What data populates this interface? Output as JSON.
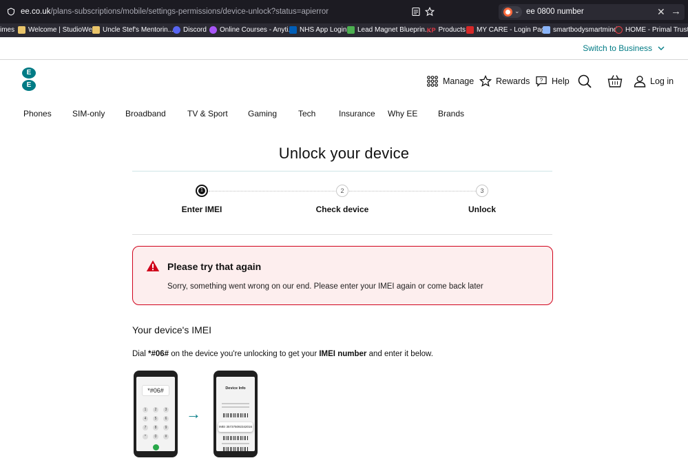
{
  "browser": {
    "url_host": "ee.co.uk",
    "url_path": "/plans-subscriptions/mobile/settings-permissions/device-unlock?status=apierror",
    "search_text": "ee 0800 number",
    "bookmarks": [
      {
        "label": "imes",
        "color": "#2b2a33"
      },
      {
        "label": "Welcome | StudioWeb",
        "color": "#e9c46a"
      },
      {
        "label": "Uncle Stef's Mentorin...",
        "color": "#e9c46a"
      },
      {
        "label": "Discord",
        "color": "#5865f2"
      },
      {
        "label": "Online Courses - Anyti...",
        "color": "#a855f7"
      },
      {
        "label": "NHS App Login",
        "color": "#005eb8"
      },
      {
        "label": "Lead Magnet Blueprin...",
        "color": "#4caf50"
      },
      {
        "label": "Products",
        "color": "#e63946"
      },
      {
        "label": "MY CARE - Login Page",
        "color": "#d62828"
      },
      {
        "label": "smartbodysmartmind",
        "color": "#8ab4f8"
      },
      {
        "label": "HOME - Primal Trust™...",
        "color": "#333333"
      }
    ],
    "bookmark_prefix_kp": "KP"
  },
  "bizbar": {
    "switch_label": "Switch to Business"
  },
  "header": {
    "logo_letters": [
      "E",
      "E"
    ],
    "manage": "Manage",
    "rewards": "Rewards",
    "help": "Help",
    "login": "Log in"
  },
  "mainnav": [
    "Phones",
    "SIM-only",
    "Broadband",
    "TV & Sport",
    "Gaming",
    "Tech",
    "Insurance",
    "Why EE",
    "Brands"
  ],
  "page": {
    "title": "Unlock your device",
    "steps": [
      {
        "number": "1",
        "label": "Enter IMEI"
      },
      {
        "number": "2",
        "label": "Check device"
      },
      {
        "number": "3",
        "label": "Unlock"
      }
    ],
    "alert": {
      "title": "Please try that again",
      "message": "Sorry, something went wrong on our end. Please enter your IMEI again or come back later"
    },
    "imei_heading": "Your device's IMEI",
    "dial": {
      "prefix": "Dial ",
      "code": "*#06#",
      "middle": " on the device you're unlocking to get your ",
      "emphasis": "IMEI number",
      "suffix": " and enter it below."
    },
    "illustration": {
      "dial_code": "*#06#",
      "keys": [
        "1",
        "2",
        "3",
        "4",
        "5",
        "6",
        "7",
        "8",
        "9",
        "*",
        "0",
        "#"
      ],
      "device_info_title": "Device Info",
      "imei_popup": "IMEI 357375092342016"
    }
  },
  "colors": {
    "accent": "#007b85",
    "error": "#d0021b",
    "error_bg": "#fdeeee"
  }
}
